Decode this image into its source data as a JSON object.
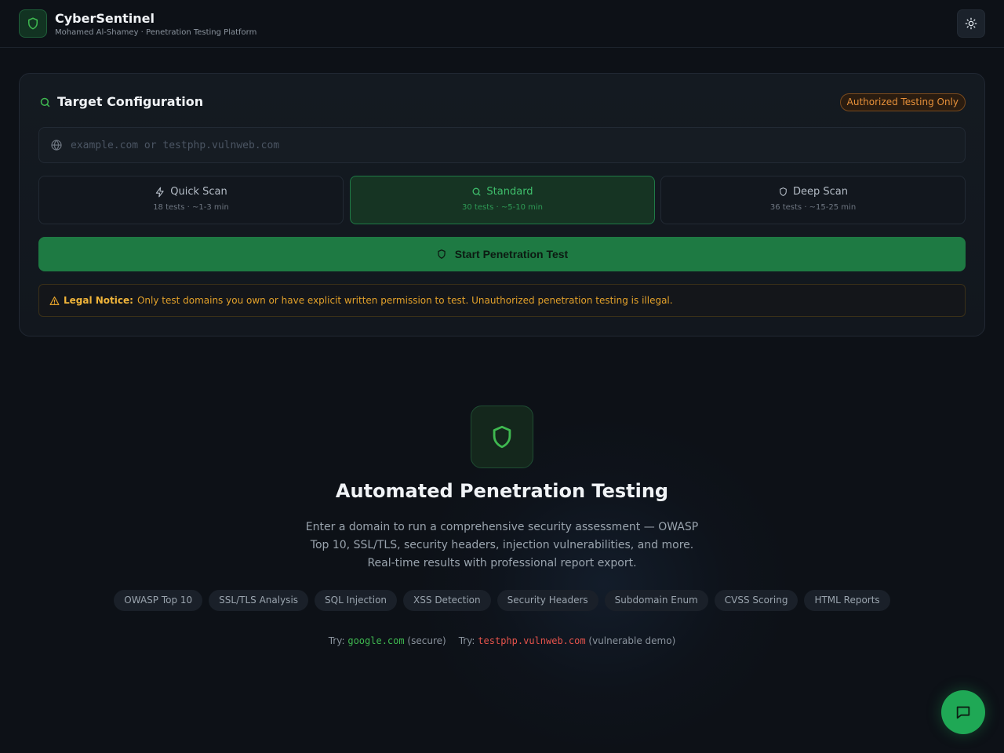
{
  "brand": {
    "title": "CyberSentinel",
    "subtitle": "Mohamed Al-Shamey · Penetration Testing Platform",
    "logo_icon": "shield-icon"
  },
  "header": {
    "theme_toggle_icon": "sun-icon"
  },
  "config": {
    "title": "Target Configuration",
    "badge": "Authorized Testing Only",
    "target_placeholder": "example.com or testphp.vulnweb.com",
    "target_value": "",
    "modes": [
      {
        "label": "Quick Scan",
        "meta": "18 tests · ~1-3 min",
        "icon": "lightning-icon",
        "active": false
      },
      {
        "label": "Standard",
        "meta": "30 tests · ~5-10 min",
        "icon": "search-icon",
        "active": true
      },
      {
        "label": "Deep Scan",
        "meta": "36 tests · ~15-25 min",
        "icon": "shield-icon",
        "active": false
      }
    ],
    "start_label": "Start Penetration Test",
    "legal_label": "Legal Notice:",
    "legal_text": "Only test domains you own or have explicit written permission to test. Unauthorized penetration testing is illegal."
  },
  "hero": {
    "title": "Automated Penetration Testing",
    "description": "Enter a domain to run a comprehensive security assessment — OWASP Top 10, SSL/TLS, security headers, injection vulnerabilities, and more. Real-time results with professional report export.",
    "chips": [
      "OWASP Top 10",
      "SSL/TLS Analysis",
      "SQL Injection",
      "XSS Detection",
      "Security Headers",
      "Subdomain Enum",
      "CVSS Scoring",
      "HTML Reports"
    ],
    "try": [
      {
        "prefix": "Try:",
        "domain": "google.com",
        "note": "(secure)"
      },
      {
        "prefix": "Try:",
        "domain": "testphp.vulnweb.com",
        "note": "(vulnerable demo)"
      }
    ]
  },
  "colors": {
    "background": "#0d1117",
    "accent_green": "#3fb950",
    "button_green": "#1e7a43",
    "warning_orange": "#e8913a",
    "danger_red": "#e5534b"
  }
}
